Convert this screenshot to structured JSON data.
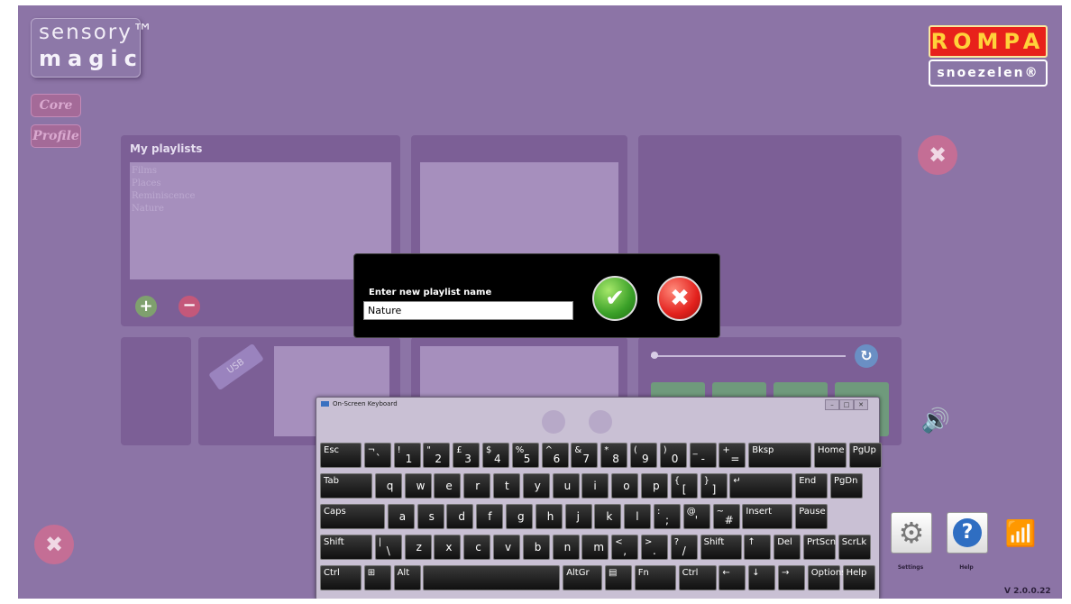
{
  "logo": {
    "line1": "sensory™",
    "line2": "magic"
  },
  "brand": {
    "rompa": "ROMPA",
    "snoezelen": "snoezelen®"
  },
  "side_buttons": {
    "core": "Core",
    "profile": "Profile"
  },
  "playlists": {
    "title": "My playlists",
    "items": [
      "Films",
      "Places",
      "Reminiscence",
      "Nature"
    ]
  },
  "usb_label": "USB",
  "dialog": {
    "title": "Enter new playlist name",
    "input_value": "Nature"
  },
  "osk": {
    "title": "On-Screen Keyboard",
    "rows": [
      [
        {
          "t": "Esc"
        },
        {
          "t": "¬",
          "b": "`"
        },
        {
          "t": "!",
          "b": "1"
        },
        {
          "t": "\"",
          "b": "2"
        },
        {
          "t": "£",
          "b": "3"
        },
        {
          "t": "$",
          "b": "4"
        },
        {
          "t": "%",
          "b": "5"
        },
        {
          "t": "^",
          "b": "6"
        },
        {
          "t": "&",
          "b": "7"
        },
        {
          "t": "*",
          "b": "8"
        },
        {
          "t": "(",
          "b": "9"
        },
        {
          "t": ")",
          "b": "0"
        },
        {
          "t": "_",
          "b": "-"
        },
        {
          "t": "+",
          "b": "="
        },
        {
          "t": "Bksp"
        },
        {
          "t": "Home"
        },
        {
          "t": "PgUp"
        }
      ],
      [
        {
          "t": "Tab"
        },
        {
          "b": "q"
        },
        {
          "b": "w"
        },
        {
          "b": "e"
        },
        {
          "b": "r"
        },
        {
          "b": "t"
        },
        {
          "b": "y"
        },
        {
          "b": "u"
        },
        {
          "b": "i"
        },
        {
          "b": "o"
        },
        {
          "b": "p"
        },
        {
          "t": "{",
          "b": "["
        },
        {
          "t": "}",
          "b": "]"
        },
        {
          "t": "↵"
        },
        {
          "t": "End"
        },
        {
          "t": "PgDn"
        }
      ],
      [
        {
          "t": "Caps"
        },
        {
          "b": "a"
        },
        {
          "b": "s"
        },
        {
          "b": "d"
        },
        {
          "b": "f"
        },
        {
          "b": "g"
        },
        {
          "b": "h"
        },
        {
          "b": "j"
        },
        {
          "b": "k"
        },
        {
          "b": "l"
        },
        {
          "t": ":",
          "b": ";"
        },
        {
          "t": "@",
          "b": "'"
        },
        {
          "t": "~",
          "b": "#"
        },
        {
          "t": "Insert"
        },
        {
          "t": "Pause"
        }
      ],
      [
        {
          "t": "Shift"
        },
        {
          "t": "|",
          "b": "\\"
        },
        {
          "b": "z"
        },
        {
          "b": "x"
        },
        {
          "b": "c"
        },
        {
          "b": "v"
        },
        {
          "b": "b"
        },
        {
          "b": "n"
        },
        {
          "b": "m"
        },
        {
          "t": "<",
          "b": ","
        },
        {
          "t": ">",
          "b": "."
        },
        {
          "t": "?",
          "b": "/"
        },
        {
          "t": "Shift"
        },
        {
          "t": "↑"
        },
        {
          "t": "Del"
        },
        {
          "t": "PrtScn"
        },
        {
          "t": "ScrLk"
        }
      ],
      [
        {
          "t": "Ctrl"
        },
        {
          "t": "⊞"
        },
        {
          "t": "Alt"
        },
        {
          "t": ""
        },
        {
          "t": "AltGr"
        },
        {
          "t": "▤"
        },
        {
          "t": "Fn"
        },
        {
          "t": "Ctrl"
        },
        {
          "t": "←"
        },
        {
          "t": "↓"
        },
        {
          "t": "→"
        },
        {
          "t": "Options"
        },
        {
          "t": "Help"
        }
      ]
    ]
  },
  "bottom_right": {
    "settings": "Settings",
    "help": "Help"
  },
  "version": "V 2.0.0.22",
  "colors": {
    "background": "#8c74a6",
    "panel": "#7c5f96",
    "ok": "#3aa028",
    "cancel": "#e3211d"
  }
}
